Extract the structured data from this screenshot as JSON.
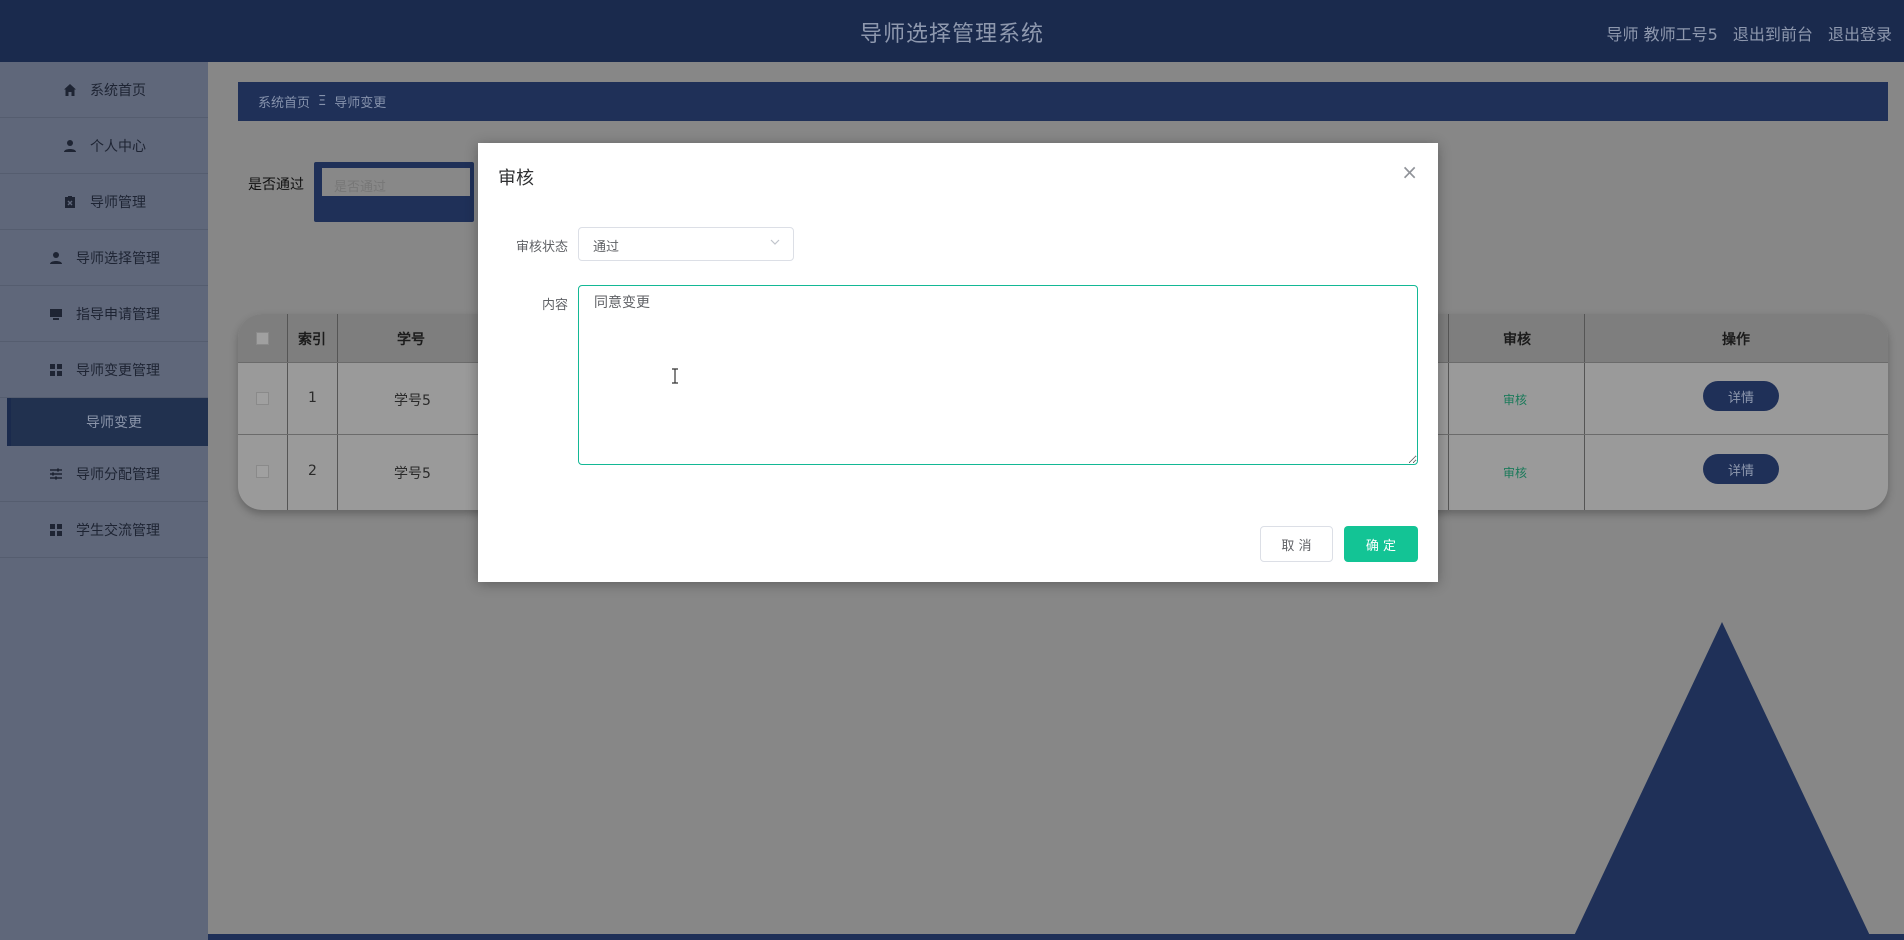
{
  "header": {
    "title": "导师选择管理系统",
    "user_info": "导师 教师工号5",
    "back_front": "退出到前台",
    "logout": "退出登录"
  },
  "sidebar": {
    "items": [
      {
        "label": "系统首页",
        "icon": "home-icon"
      },
      {
        "label": "个人中心",
        "icon": "user-icon"
      },
      {
        "label": "导师管理",
        "icon": "clipboard-icon"
      },
      {
        "label": "导师选择管理",
        "icon": "user-icon"
      },
      {
        "label": "指导申请管理",
        "icon": "monitor-icon"
      },
      {
        "label": "导师变更管理",
        "icon": "grid-icon"
      },
      {
        "label": "导师分配管理",
        "icon": "sliders-icon"
      },
      {
        "label": "学生交流管理",
        "icon": "grid-icon"
      }
    ],
    "sub_item": "导师变更"
  },
  "breadcrumb": {
    "home": "系统首页",
    "separator": "Ξ",
    "current": "导师变更"
  },
  "filter": {
    "label": "是否通过",
    "placeholder": "是否通过"
  },
  "table": {
    "columns": [
      "索引",
      "学号",
      "审核",
      "操作"
    ],
    "rows": [
      {
        "index": "1",
        "student_id": "学号5",
        "audit": "审核",
        "action": "详情"
      },
      {
        "index": "2",
        "student_id": "学号5",
        "audit": "审核",
        "action": "详情"
      }
    ]
  },
  "modal": {
    "title": "审核",
    "close": "×",
    "status_label": "审核状态",
    "status_value": "通过",
    "content_label": "内容",
    "content_value": "同意变更",
    "cancel": "取 消",
    "confirm": "确 定"
  },
  "colors": {
    "navy": "#1f3058",
    "accent": "#13c495"
  }
}
